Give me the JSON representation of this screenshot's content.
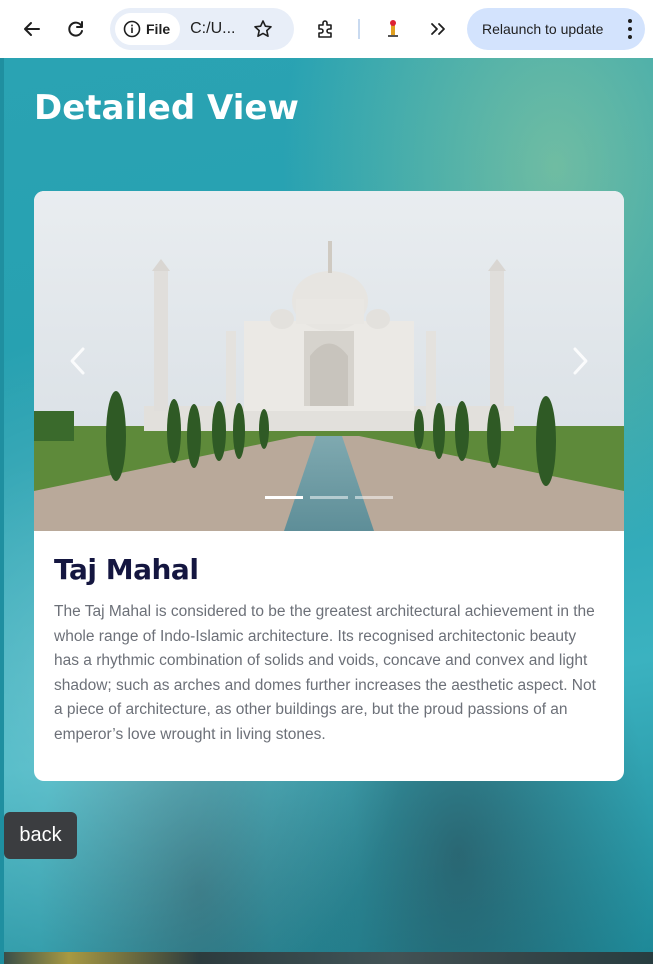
{
  "browser": {
    "chip_label": "File",
    "url": "C:/U...",
    "relaunch_label": "Relaunch to update"
  },
  "page": {
    "title": "Detailed View"
  },
  "card": {
    "title": "Taj Mahal",
    "description": "The Taj Mahal is considered to be the greatest architectural achievement in the whole range of Indo-Islamic architecture. Its recognised architectonic beauty has a rhythmic combination of solids and voids, concave and convex and light shadow; such as arches and domes further increases the aesthetic aspect. Not a piece of architecture, as other buildings are, but the proud passions of an emperor’s love wrought in living stones."
  },
  "carousel": {
    "slide_count": 3,
    "active_slide": 1
  },
  "back_button": {
    "label": "back"
  },
  "colors": {
    "accent": "#d3e3fd",
    "title_color": "#141640",
    "background": "#2aa3b3"
  }
}
